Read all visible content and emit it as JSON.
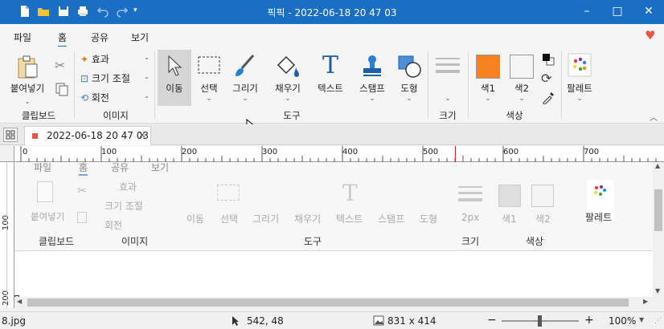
{
  "window": {
    "title": "픽픽 - 2022-06-18 20 47 03"
  },
  "menu": {
    "tabs": [
      "파일",
      "홈",
      "공유",
      "보기"
    ]
  },
  "ribbon": {
    "clipboard": {
      "paste": "붙여넣기",
      "group": "클립보드"
    },
    "image": {
      "effects": "효과",
      "resize": "크기 조절",
      "rotate": "회전",
      "group": "이미지"
    },
    "tools": {
      "move": "이동",
      "select": "선택",
      "draw": "그리기",
      "fill": "채우기",
      "text": "텍스트",
      "stamp": "스탬프",
      "shape": "도형",
      "group": "도구"
    },
    "size": {
      "group": "크기"
    },
    "colors": {
      "color1": "색1",
      "color2": "색2",
      "group": "색상"
    },
    "palette": {
      "label": "팔레트"
    },
    "accent1": "#f5821f",
    "accent2": "#f5f5f5"
  },
  "doc_tab": {
    "label": "2022-06-18 20 47 03",
    "close": "×"
  },
  "ruler": {
    "h_labels": [
      "0",
      "100",
      "200",
      "300",
      "400",
      "500",
      "600",
      "700"
    ],
    "v_labels": [
      "100",
      "200"
    ]
  },
  "canvas_content": {
    "tabs": [
      "파일",
      "홈",
      "공유",
      "보기"
    ],
    "clipboard_paste": "붙여넣기",
    "clipboard_group": "클립보드",
    "effects": "효과",
    "resize": "크기 조절",
    "rotate": "회전",
    "image_group": "이미지",
    "move": "이동",
    "select": "선택",
    "draw": "그리기",
    "fill": "채우기",
    "text": "텍스트",
    "stamp": "스탬프",
    "shape": "도형",
    "tools_group": "도구",
    "size_value": "2px",
    "size_group": "크기",
    "color1": "색1",
    "color2": "색2",
    "color_group": "색상",
    "palette": "팔레트"
  },
  "status": {
    "filename": "8.jpg",
    "cursor_pos": "542, 48",
    "image_size": "831 x 414",
    "zoom": "100%",
    "zoom_minus": "−",
    "zoom_plus": "+"
  }
}
